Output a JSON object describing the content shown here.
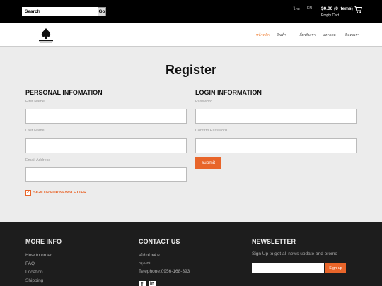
{
  "header": {
    "search_placeholder": "Search",
    "go_label": "Go",
    "lang_1": "ไทย",
    "lang_2": "EN",
    "cart_amount": "$0.00 (0 items)",
    "cart_status": "Empty Cart"
  },
  "nav": {
    "logo_text": "ABOVE UP",
    "items": [
      "หน้าหลัก",
      "สินค้า",
      "เกี่ยวกับเรา",
      "บทความ",
      "ติดต่อเรา"
    ]
  },
  "main": {
    "title": "Register",
    "personal": {
      "heading": "PERSONAL INFOMATION",
      "first_name_label": "First Name",
      "last_name_label": "Last Name",
      "email_label": "Email Address"
    },
    "login": {
      "heading": "LOGIN INFORMATION",
      "password_label": "Password",
      "confirm_label": "Confirm Password",
      "submit_label": "submit"
    },
    "newsletter_check_label": "SIGN UP FOR NEWSLETTER",
    "newsletter_checked": true
  },
  "footer": {
    "more_info": {
      "heading": "MORE INFO",
      "links": [
        "How to order",
        "FAQ",
        "Location",
        "Shipping"
      ]
    },
    "contact": {
      "heading": "CONTACT US",
      "lines": [
        "บริษัทตัวอย่าง",
        "กรุงเทพ",
        "Telephone:0956-168-393"
      ]
    },
    "newsletter": {
      "heading": "NEWSLETTER",
      "text": "Sign Up to get all news update and promo",
      "button_label": "Sign up"
    }
  },
  "colors": {
    "accent": "#e8652a",
    "topbar": "#000000",
    "footer": "#1d1d1d"
  }
}
